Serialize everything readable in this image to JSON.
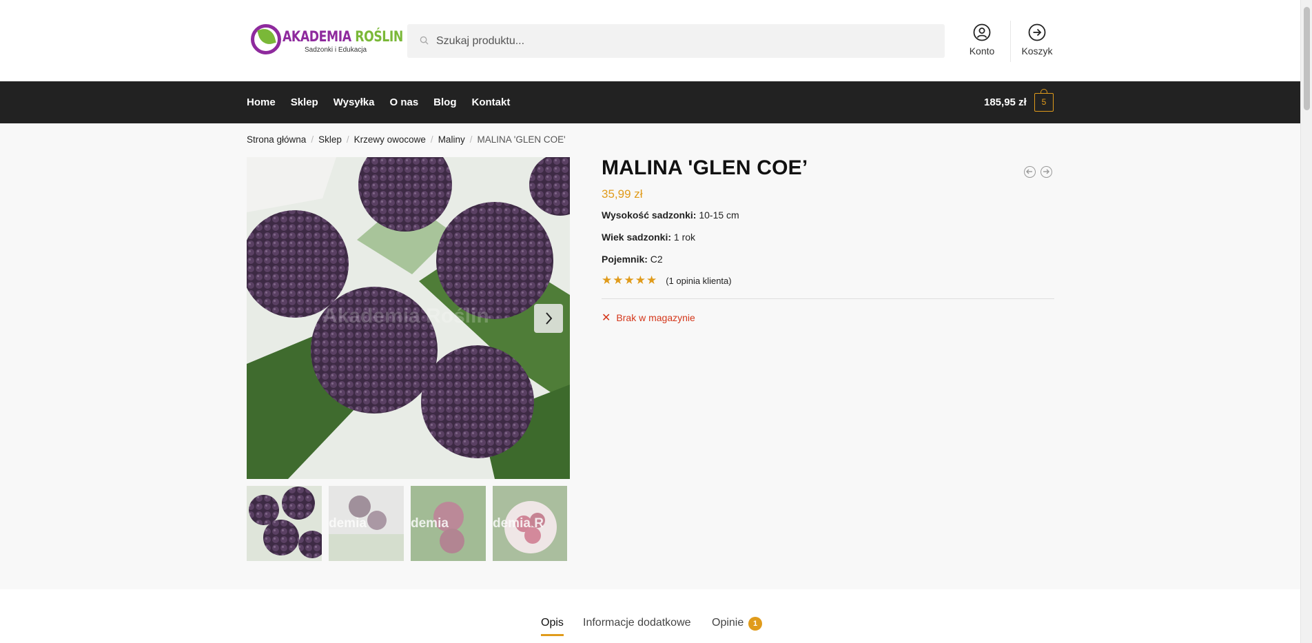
{
  "logo": {
    "title_part1": "AKADEMIA",
    "title_part2": "ROŚLIN",
    "subtitle": "Sadzonki i Edukacja"
  },
  "search": {
    "placeholder": "Szukaj produktu..."
  },
  "header_actions": {
    "account_label": "Konto",
    "cart_label": "Koszyk"
  },
  "nav": {
    "items": [
      "Home",
      "Sklep",
      "Wysyłka",
      "O nas",
      "Blog",
      "Kontakt"
    ]
  },
  "cart": {
    "total": "185,95 zł",
    "count": "5"
  },
  "breadcrumb": {
    "items": [
      "Strona główna",
      "Sklep",
      "Krzewy owocowe",
      "Maliny"
    ],
    "current": "MALINA 'GLEN COE'"
  },
  "gallery": {
    "watermark": "Akademia Roślin",
    "thumb_watermarks": [
      "demia",
      "demia",
      "demia R"
    ]
  },
  "product": {
    "title": "MALINA 'GLEN COE’",
    "price": "35,99 zł",
    "attributes": [
      {
        "label": "Wysokość sadzonki:",
        "value": "10-15 cm"
      },
      {
        "label": "Wiek sadzonki:",
        "value": "1 rok"
      },
      {
        "label": "Pojemnik:",
        "value": "C2"
      }
    ],
    "rating": {
      "stars": "★★★★★",
      "value": 5,
      "count_text": "(1 opinia klienta)"
    },
    "stock": {
      "icon": "x-icon",
      "text": "Brak w magazynie"
    }
  },
  "tabs": [
    {
      "label": "Opis",
      "active": true
    },
    {
      "label": "Informacje dodatkowe",
      "active": false
    },
    {
      "label": "Opinie",
      "active": false,
      "badge": "1"
    }
  ],
  "colors": {
    "accent": "#e09b1b",
    "nav_bg": "#222222",
    "out_of_stock": "#d4361a",
    "brand_purple": "#8e2a9d",
    "brand_green": "#7ab838"
  }
}
